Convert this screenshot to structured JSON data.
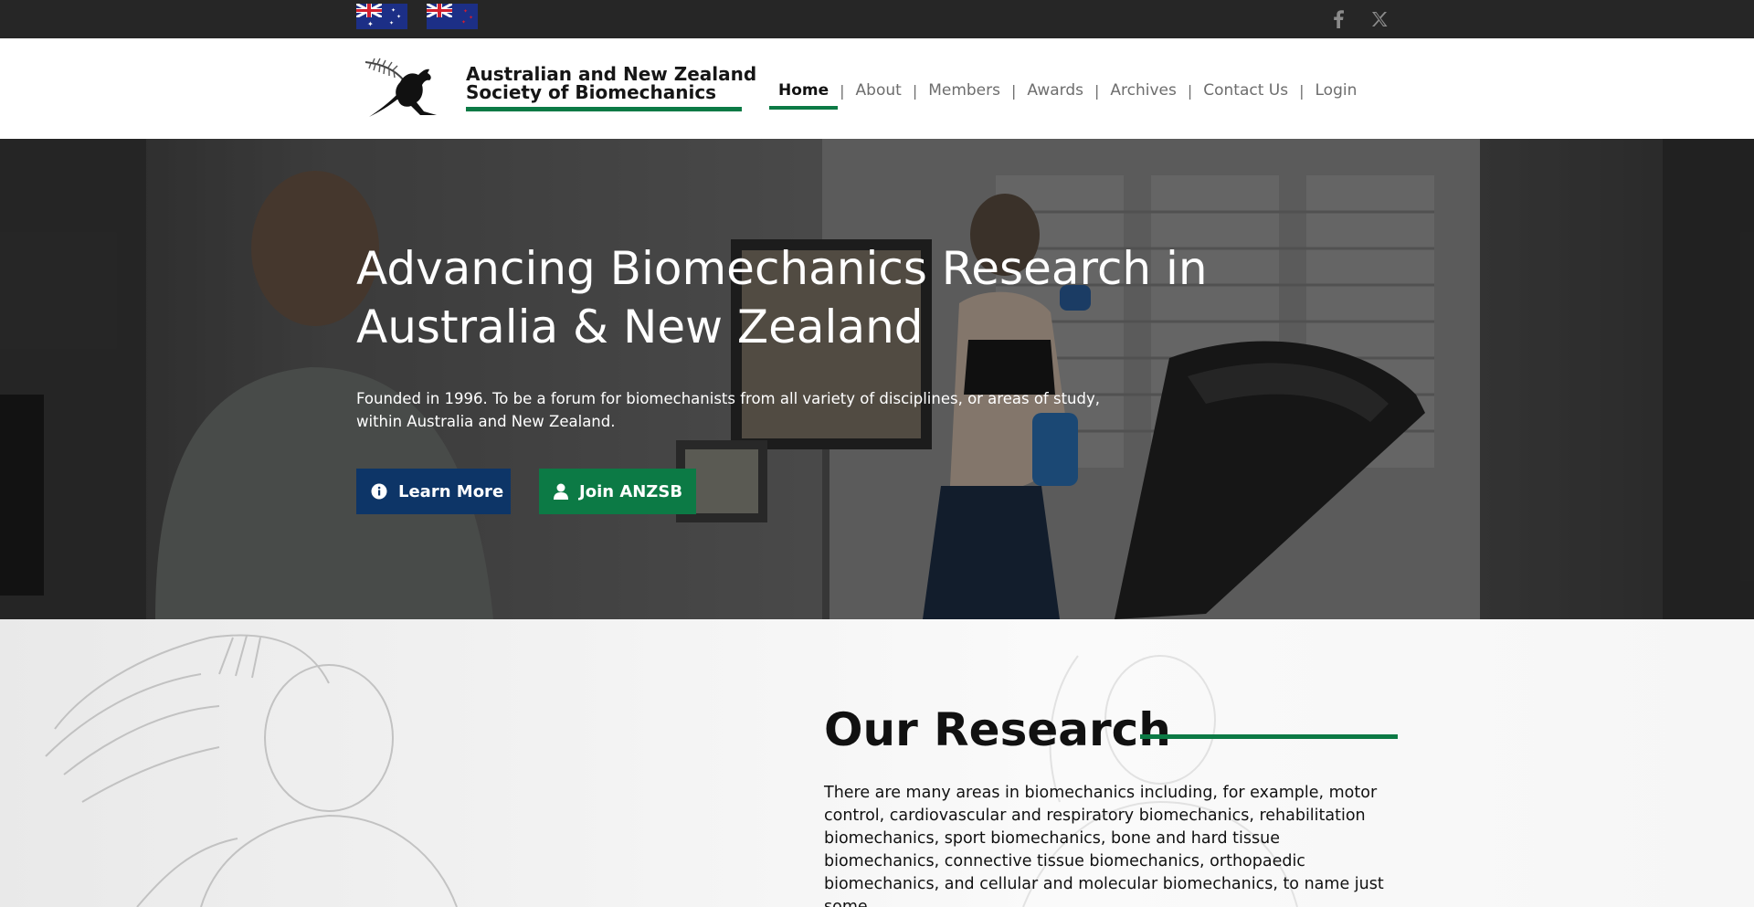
{
  "topbar": {
    "flags": [
      {
        "name": "Australia"
      },
      {
        "name": "New Zealand"
      }
    ],
    "social": [
      {
        "icon": "facebook-icon"
      },
      {
        "icon": "x-twitter-icon"
      }
    ]
  },
  "header": {
    "brand_line1": "Australian and New Zealand",
    "brand_line2": "Society of Biomechanics",
    "nav": [
      {
        "label": "Home",
        "active": true
      },
      {
        "label": "About"
      },
      {
        "label": "Members"
      },
      {
        "label": "Awards"
      },
      {
        "label": "Archives"
      },
      {
        "label": "Contact Us"
      },
      {
        "label": "Login"
      }
    ],
    "nav_separator": "|"
  },
  "hero": {
    "title": "Advancing Biomechanics Research in Australia & New Zealand",
    "text": "Founded in 1996. To be a forum for biomechanists from all variety of disciplines, or areas of study, within Australia and New Zealand.",
    "learn_more": "Learn More",
    "join": "Join ANZSB"
  },
  "research": {
    "title": "Our Research",
    "text": "There are many areas in biomechanics including, for example, motor control, cardiovascular and respiratory biomechanics, rehabilitation biomechanics, sport biomechanics, bone and hard tissue biomechanics, connective tissue biomechanics, orthopaedic biomechanics, and cellular and molecular biomechanics, to name just some."
  },
  "colors": {
    "accent_green": "#0c7a45",
    "navy": "#0d3567",
    "topbar": "#262626"
  }
}
